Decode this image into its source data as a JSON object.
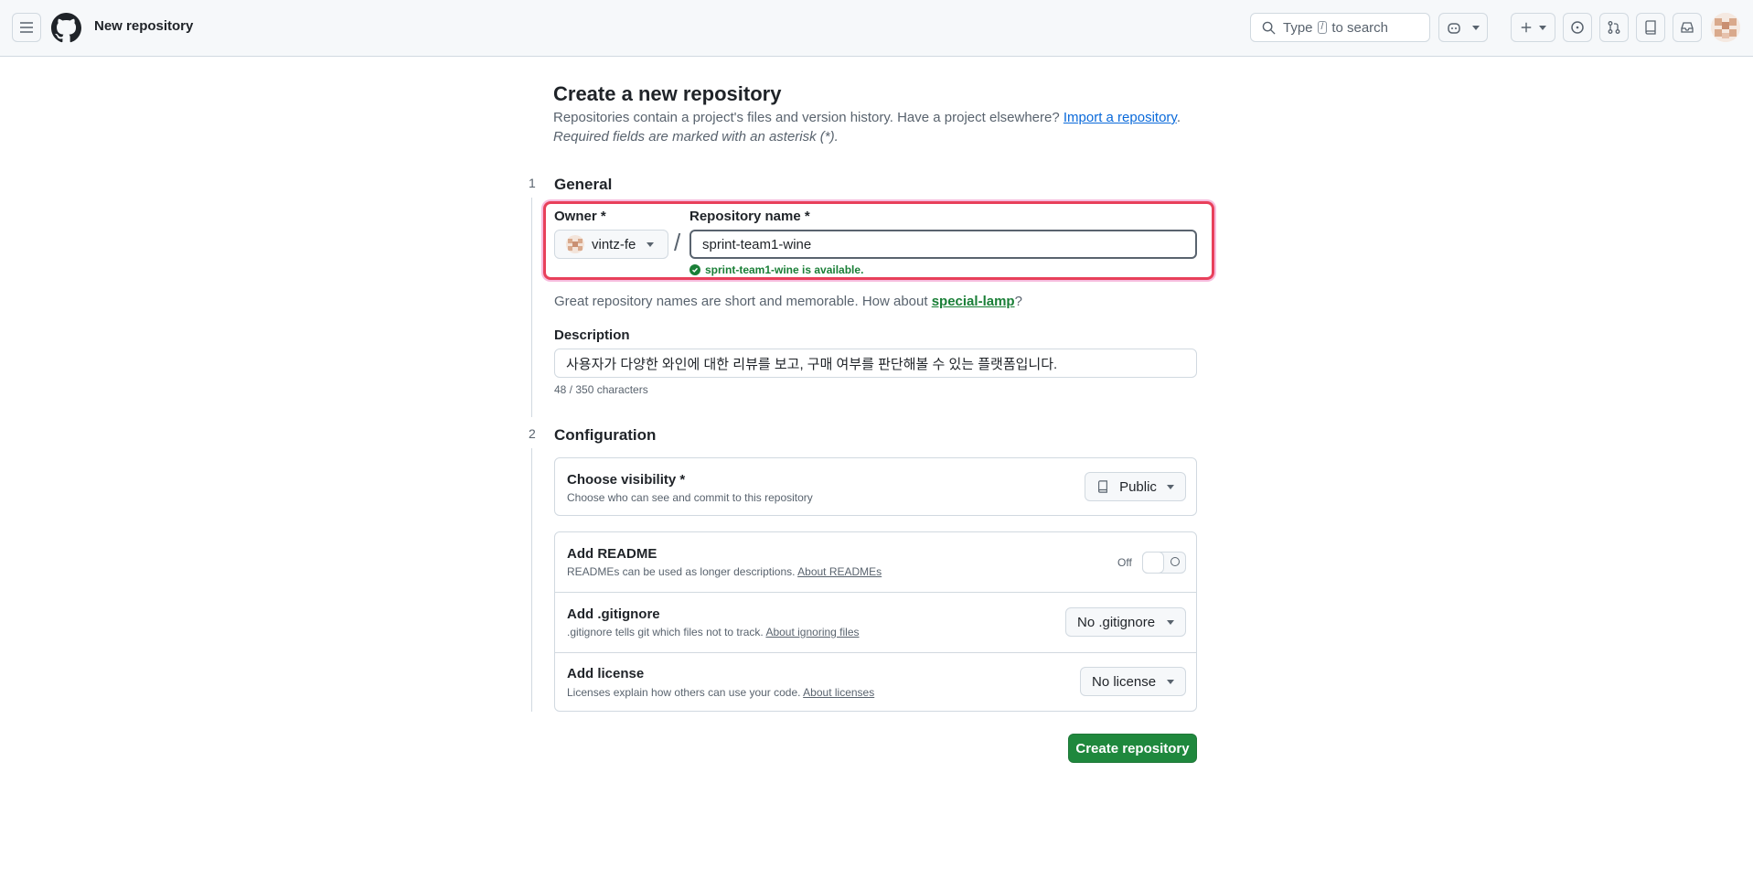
{
  "header": {
    "context_title": "New repository",
    "search": {
      "prefix": "Type",
      "key": "/",
      "suffix": "to search"
    }
  },
  "page": {
    "title": "Create a new repository",
    "subtitle_text": "Repositories contain a project's files and version history. Have a project elsewhere?",
    "import_link": "Import a repository",
    "subtitle_end": ".",
    "required_note": "Required fields are marked with an asterisk (*)."
  },
  "general": {
    "step": "1",
    "title": "General",
    "owner_label": "Owner *",
    "owner_value": "vintz-fe",
    "separator": "/",
    "repo_name_label": "Repository name *",
    "repo_name_value": "sprint-team1-wine",
    "availability": "sprint-team1-wine is available.",
    "suggestion_prefix": "Great repository names are short and memorable. How about",
    "suggestion_name": "special-lamp",
    "suggestion_suffix": "?",
    "description_label": "Description",
    "description_value": "사용자가 다양한 와인에 대한 리뷰를 보고, 구매 여부를 판단해볼 수 있는 플랫폼입니다.",
    "char_count": "48 / 350 characters"
  },
  "configuration": {
    "step": "2",
    "title": "Configuration",
    "visibility": {
      "title": "Choose visibility *",
      "desc": "Choose who can see and commit to this repository",
      "value": "Public"
    },
    "readme": {
      "title": "Add README",
      "desc": "READMEs can be used as longer descriptions.",
      "link": "About READMEs",
      "state": "Off"
    },
    "gitignore": {
      "title": "Add .gitignore",
      "desc": ".gitignore tells git which files not to track.",
      "link": "About ignoring files",
      "value": "No .gitignore"
    },
    "license": {
      "title": "Add license",
      "desc": "Licenses explain how others can use your code.",
      "link": "About licenses",
      "value": "No license"
    }
  },
  "actions": {
    "create": "Create repository"
  },
  "colors": {
    "primary_button": "#1f883d",
    "link": "#0969da",
    "success": "#1a7f37",
    "highlight": "#e8405b"
  }
}
